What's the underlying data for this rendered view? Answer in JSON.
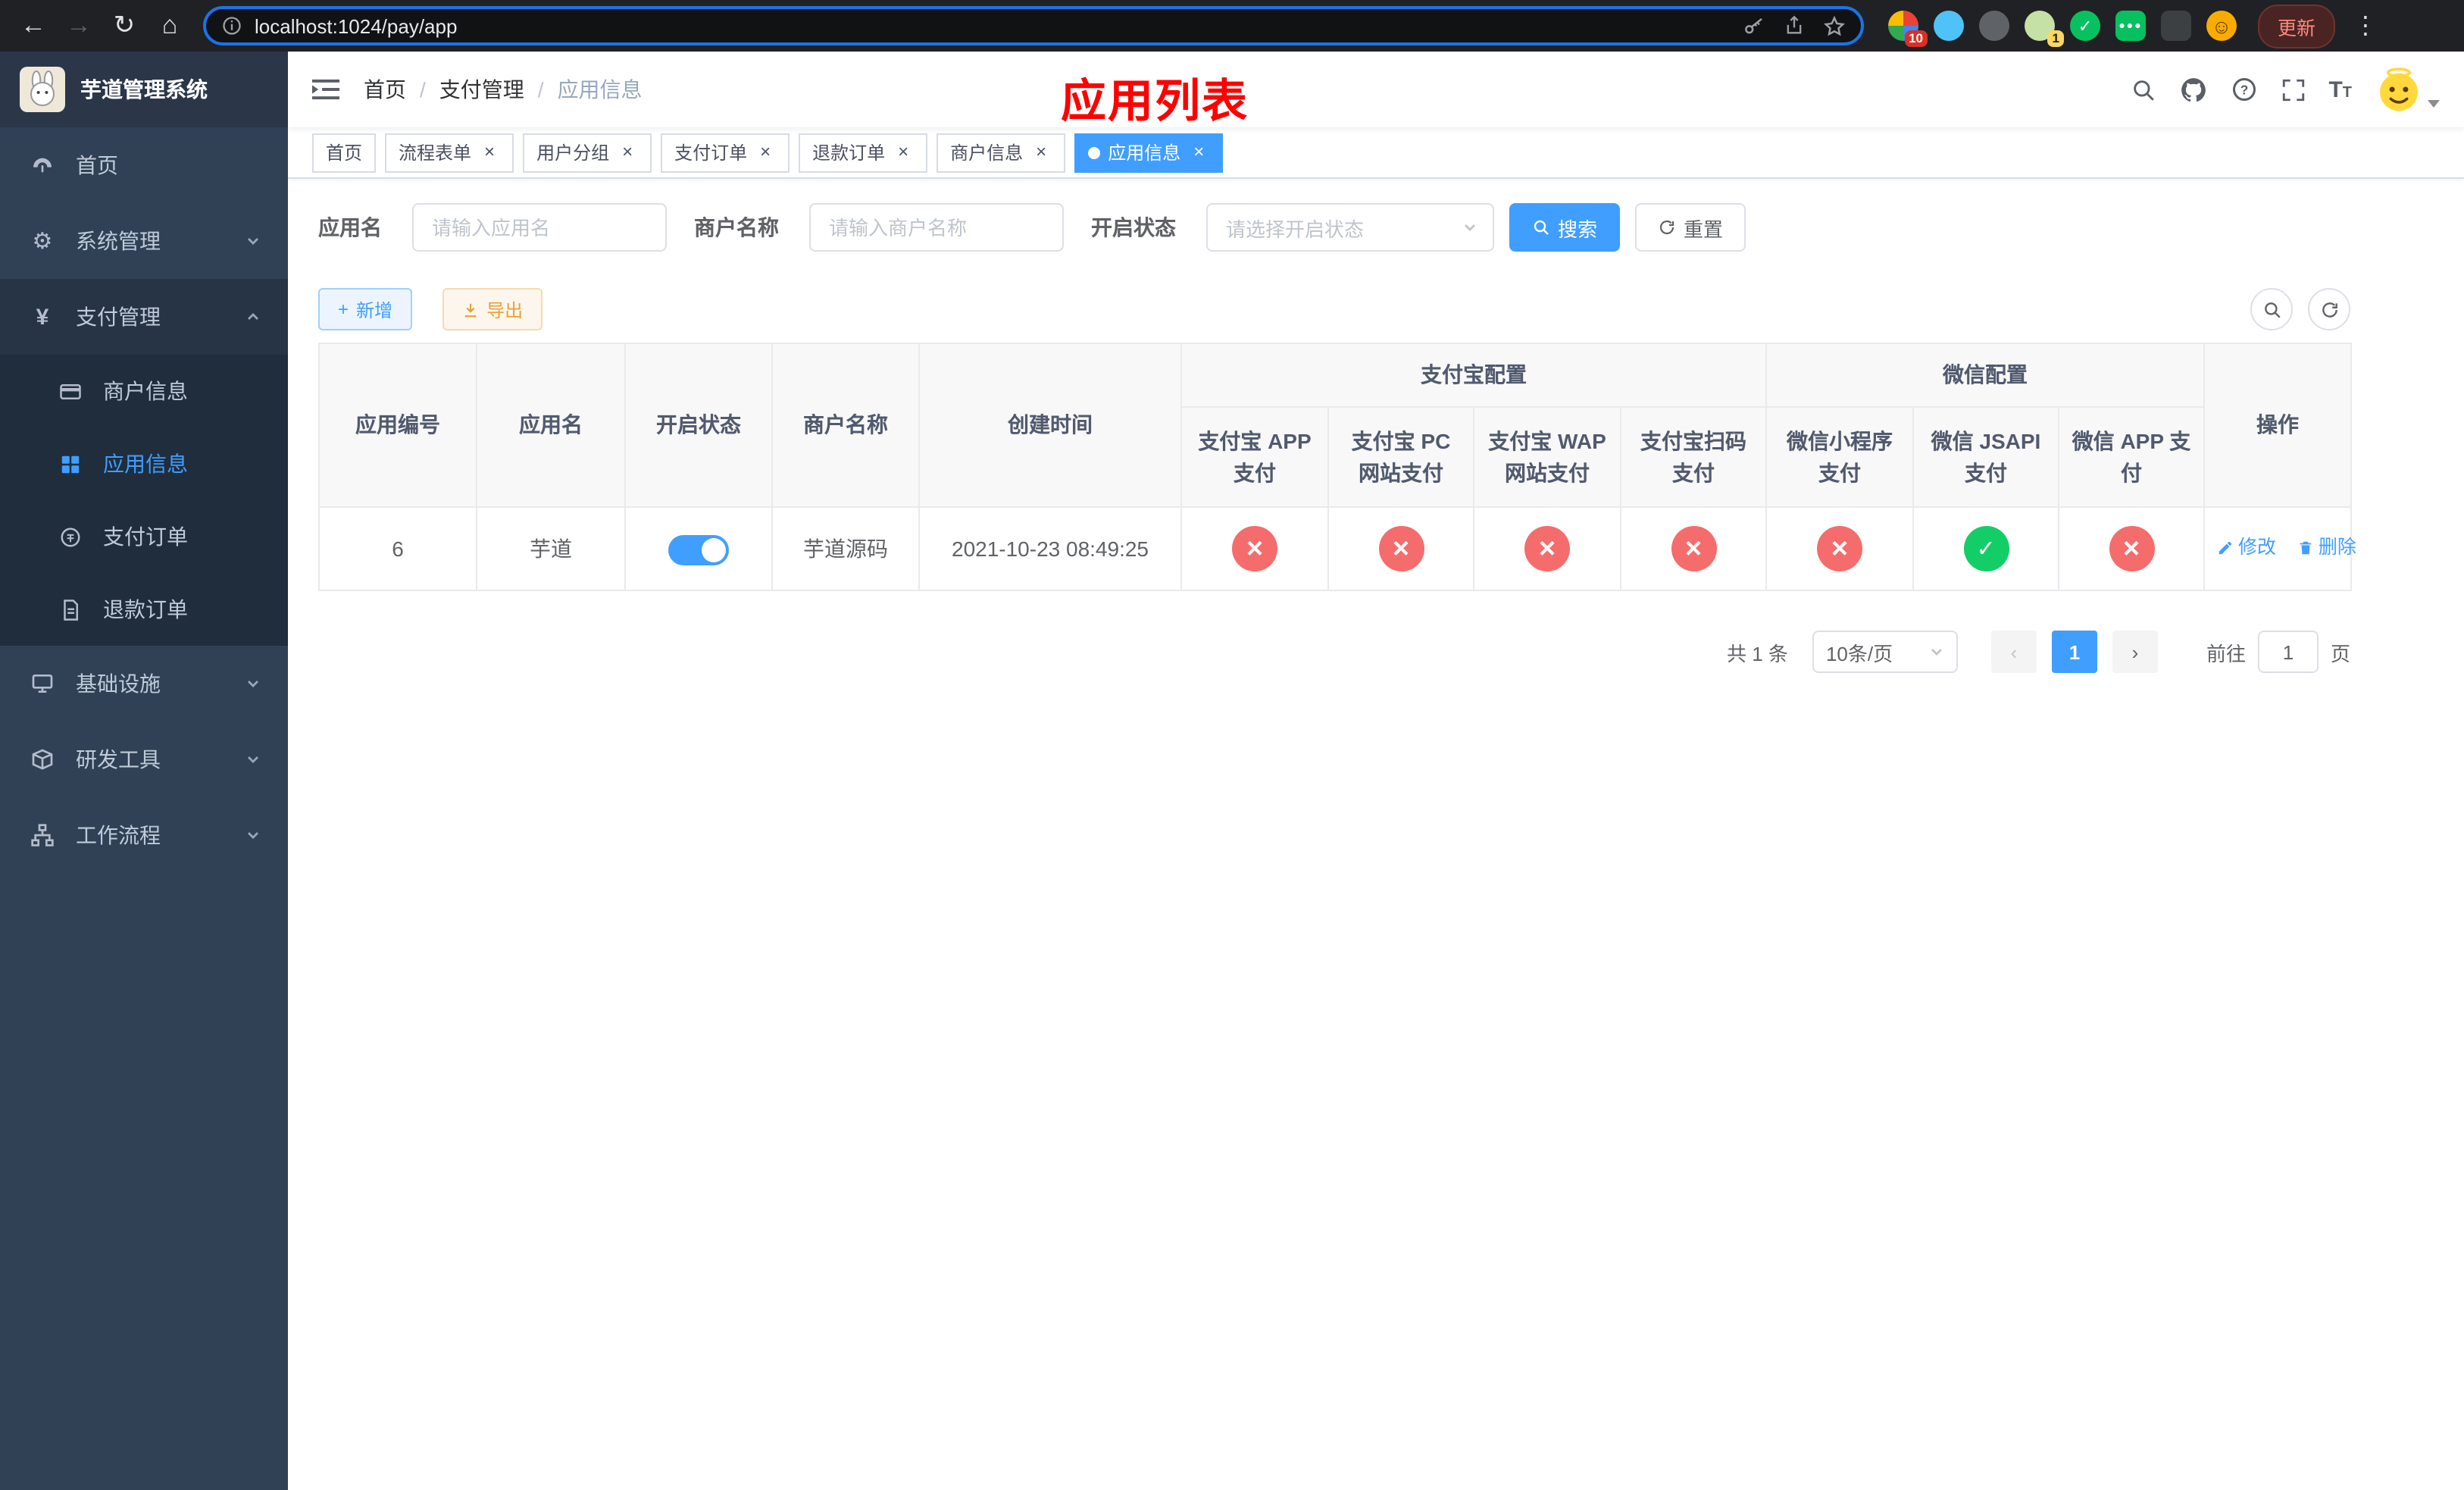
{
  "colors": {
    "primary": "#409EFF",
    "danger": "#f56c6c",
    "success": "#13ce66",
    "warning": "#e6a23c",
    "page_title_red": "#ff0000",
    "sidebar_bg": "#304156",
    "submenu_bg": "#1f2d3d"
  },
  "browser": {
    "url": "localhost:1024/pay/app",
    "update_label": "更新",
    "ext_badge_primary": "10",
    "ext_badge_secondary": "1"
  },
  "sidebar": {
    "logo_title": "芋道管理系统",
    "menu": [
      {
        "label": "首页"
      },
      {
        "label": "系统管理"
      },
      {
        "label": "支付管理"
      },
      {
        "label": "基础设施"
      },
      {
        "label": "研发工具"
      },
      {
        "label": "工作流程"
      }
    ],
    "submenu_pay": [
      {
        "label": "商户信息"
      },
      {
        "label": "应用信息"
      },
      {
        "label": "支付订单"
      },
      {
        "label": "退款订单"
      }
    ]
  },
  "header": {
    "breadcrumb": [
      "首页",
      "支付管理",
      "应用信息"
    ],
    "page_title": "应用列表"
  },
  "tabs": [
    {
      "label": "首页"
    },
    {
      "label": "流程表单"
    },
    {
      "label": "用户分组"
    },
    {
      "label": "支付订单"
    },
    {
      "label": "退款订单"
    },
    {
      "label": "商户信息"
    },
    {
      "label": "应用信息"
    }
  ],
  "filters": {
    "app_name_label": "应用名",
    "app_name_placeholder": "请输入应用名",
    "merchant_label": "商户名称",
    "merchant_placeholder": "请输入商户名称",
    "status_label": "开启状态",
    "status_placeholder": "请选择开启状态",
    "search_label": "搜索",
    "reset_label": "重置"
  },
  "toolbar": {
    "add_label": "新增",
    "export_label": "导出"
  },
  "table": {
    "headers": {
      "app_id": "应用编号",
      "app_name": "应用名",
      "status": "开启状态",
      "merchant": "商户名称",
      "created": "创建时间",
      "alipay_group": "支付宝配置",
      "wechat_group": "微信配置",
      "alipay_app": "支付宝 APP 支付",
      "alipay_pc": "支付宝 PC 网站支付",
      "alipay_wap": "支付宝 WAP 网站支付",
      "alipay_qr": "支付宝扫码支付",
      "wx_mini": "微信小程序支付",
      "wx_jsapi": "微信 JSAPI 支付",
      "wx_app": "微信 APP 支付",
      "actions": "操作"
    },
    "rows": [
      {
        "app_id": "6",
        "app_name": "芋道",
        "status": "on",
        "merchant": "芋道源码",
        "created": "2021-10-23 08:49:25",
        "alipay_app": "error",
        "alipay_pc": "error",
        "alipay_wap": "error",
        "alipay_qr": "error",
        "wx_mini": "error",
        "wx_jsapi": "success",
        "wx_app": "error",
        "edit_label": "修改",
        "delete_label": "删除"
      }
    ]
  },
  "pagination": {
    "total_text": "共 1 条",
    "page_size": "10条/页",
    "prev_label": "‹",
    "next_label": "›",
    "current_page": "1",
    "goto_prefix": "前往",
    "goto_value": "1",
    "goto_suffix": "页"
  }
}
